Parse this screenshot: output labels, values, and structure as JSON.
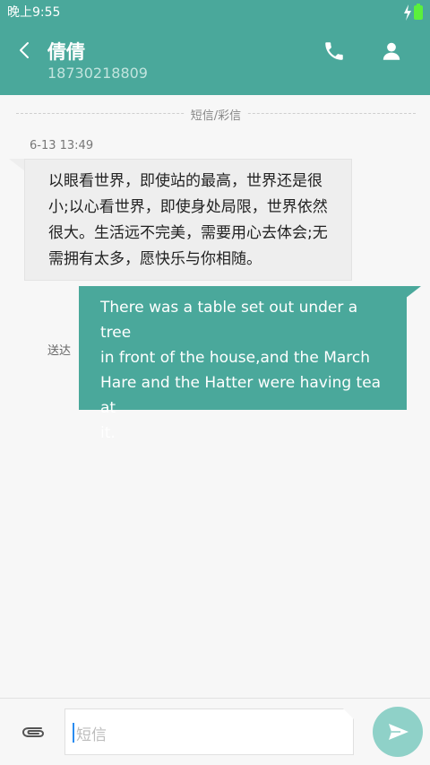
{
  "status_bar": {
    "time": "晚上9:55"
  },
  "header": {
    "contact_name": "倩倩",
    "contact_number": "18730218809"
  },
  "divider_label": "短信/彩信",
  "messages": [
    {
      "timestamp": "6-13 13:49",
      "direction": "incoming",
      "lines": [
        "以眼看世界，即使站的最高，世界还是很",
        "小;以心看世界，即使身处局限，世界依然",
        "很大。生活远不完美，需要用心去体会;无",
        "需拥有太多，愿快乐与你相随。"
      ]
    },
    {
      "direction": "outgoing",
      "status": "送达",
      "lines": [
        "There was a table set out under a tree",
        "in front of the house,and the March",
        "Hare and the Hatter were having tea at",
        "it."
      ]
    }
  ],
  "compose": {
    "placeholder": "短信"
  },
  "colors": {
    "accent": "#4aa89b",
    "send_button": "#8fd1c8",
    "battery": "#5bf03c"
  },
  "icons": [
    "bolt-icon",
    "battery-icon",
    "back-icon",
    "phone-icon",
    "person-icon",
    "paperclip-icon",
    "send-icon"
  ]
}
